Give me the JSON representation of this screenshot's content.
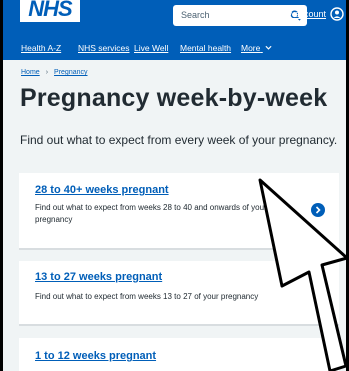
{
  "header": {
    "logo": "NHS",
    "search_placeholder": "Search",
    "account_label": "My account"
  },
  "nav": [
    "Health A-Z",
    "NHS services",
    "Live Well",
    "Mental health",
    "More"
  ],
  "breadcrumb": [
    "Home",
    "Pregnancy"
  ],
  "page": {
    "title": "Pregnancy week-by-week",
    "lede": "Find out what to expect from every week of your pregnancy."
  },
  "cards": [
    {
      "title": "28 to 40+ weeks pregnant",
      "desc": "Find out what to expect from weeks 28 to 40 and onwards of your pregnancy"
    },
    {
      "title": "13 to 27 weeks pregnant",
      "desc": "Find out what to expect from weeks 13 to 27 of your pregnancy"
    },
    {
      "title": "1 to 12 weeks pregnant",
      "desc": ""
    }
  ],
  "colors": {
    "brand": "#005eb8",
    "text": "#212b32",
    "background": "#f0f4f5"
  },
  "icons": [
    "search-icon",
    "account-icon",
    "chevron-down-icon",
    "chevron-right-icon",
    "cursor-arrow-icon"
  ]
}
